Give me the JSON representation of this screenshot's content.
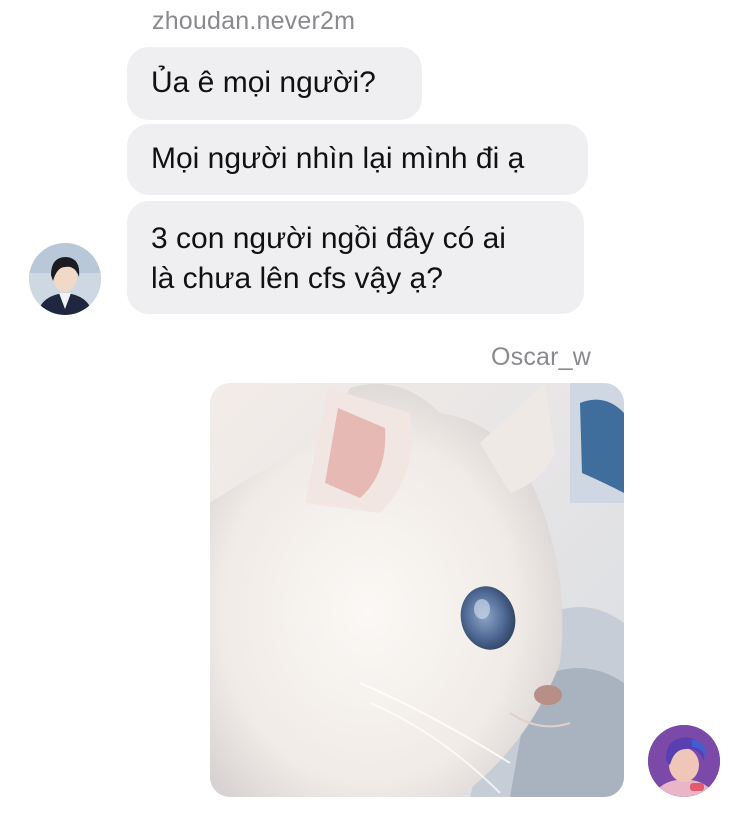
{
  "chat": {
    "messages_incoming": {
      "sender": "zhoudan.never2m",
      "texts": [
        "Ủa ê mọi người?",
        "Mọi người nhìn lại mình đi ạ",
        "3 con người ngồi đây có ai",
        "là chưa lên cfs vậy ạ?"
      ],
      "avatar_icon": "user-avatar-dark-hair"
    },
    "messages_outgoing": {
      "sender": "Oscar_w",
      "attachment": "white-cat-photo",
      "avatar_icon": "user-avatar-purple-hair"
    }
  },
  "colors": {
    "bubble_bg": "#efeff2",
    "name_text": "#8a8a8e"
  }
}
